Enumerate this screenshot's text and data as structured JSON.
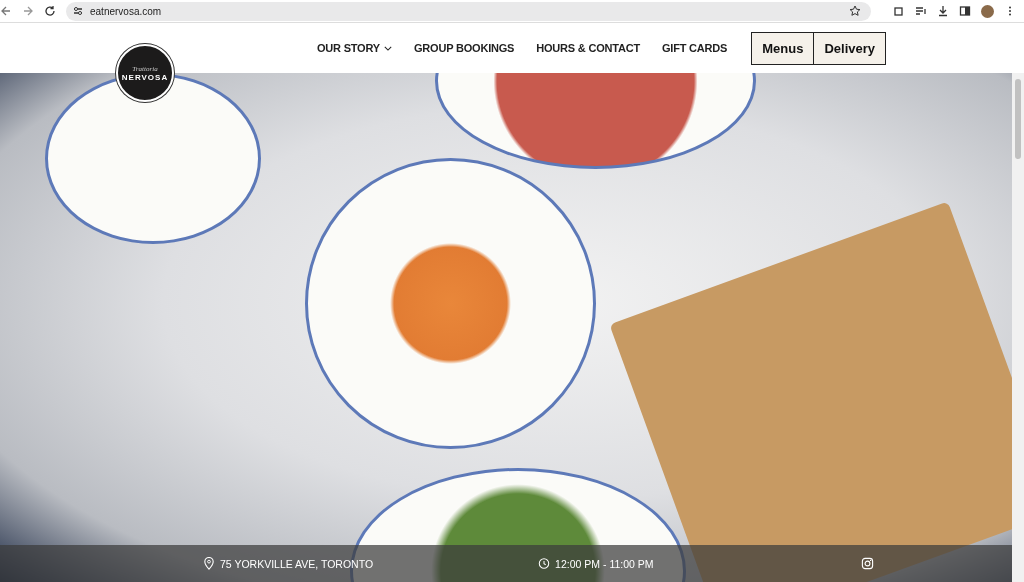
{
  "browser": {
    "url": "eatnervosa.com"
  },
  "logo": {
    "script": "Trattoria",
    "name": "NERVOSA"
  },
  "nav": {
    "items": [
      {
        "label": "OUR STORY",
        "dropdown": true
      },
      {
        "label": "GROUP BOOKINGS",
        "dropdown": false
      },
      {
        "label": "HOURS & CONTACT",
        "dropdown": false
      },
      {
        "label": "GIFT CARDS",
        "dropdown": false
      }
    ],
    "buttons": [
      "Menus",
      "Delivery"
    ]
  },
  "info_bar": {
    "address": "75 YORKVILLE AVE, TORONTO",
    "hours": "12:00 PM - 11:00 PM"
  }
}
